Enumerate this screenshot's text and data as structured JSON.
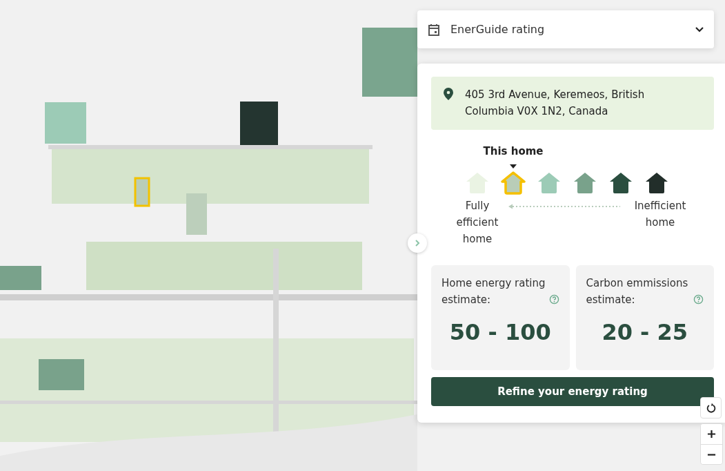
{
  "dropdown": {
    "label": "EnerGuide rating"
  },
  "address": "405 3rd Avenue, Keremeos, British Columbia V0X 1N2, Canada",
  "scale": {
    "marker_label": "This home",
    "left_label": "Fully efficient home",
    "right_label": "Inefficient home",
    "houses": [
      {
        "color": "#eaf3e3",
        "selected": false
      },
      {
        "color": "#b9cdb8",
        "selected": true
      },
      {
        "color": "#9ccbb6",
        "selected": false
      },
      {
        "color": "#79a28b",
        "selected": false
      },
      {
        "color": "#2a4e3f",
        "selected": false
      },
      {
        "color": "#222e2a",
        "selected": false
      }
    ]
  },
  "estimates": [
    {
      "label": "Home energy rating estimate:",
      "value": "50 - 100"
    },
    {
      "label": "Carbon emmissions estimate:",
      "value": "20 - 25"
    }
  ],
  "button": "Refine your energy rating"
}
